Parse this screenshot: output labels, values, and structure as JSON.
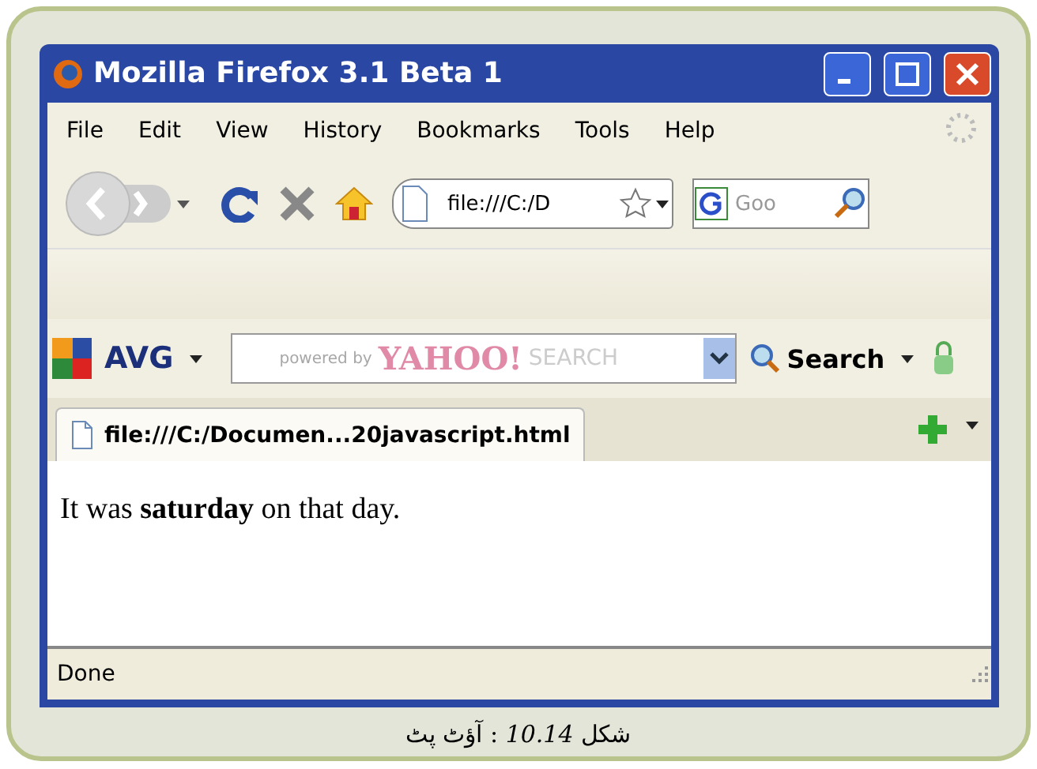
{
  "window": {
    "title": "Mozilla Firefox 3.1 Beta 1"
  },
  "menu": [
    "File",
    "Edit",
    "View",
    "History",
    "Bookmarks",
    "Tools",
    "Help"
  ],
  "address": {
    "value": "file:///C:/D"
  },
  "web_search": {
    "placeholder": "Goo"
  },
  "avg_toolbar": {
    "label": "AVG",
    "powered_by": "powered by",
    "brand": "YAHOO!",
    "search_word": "SEARCH",
    "search_button": "Search"
  },
  "tabs": [
    {
      "label": "file:///C:/Documen...20javascript.html",
      "selected": true
    }
  ],
  "page": {
    "text": "It was **saturday** on that day."
  },
  "status_bar": {
    "text": "Done"
  },
  "caption": "شکل *10.14* : آؤٹ پٹ"
}
